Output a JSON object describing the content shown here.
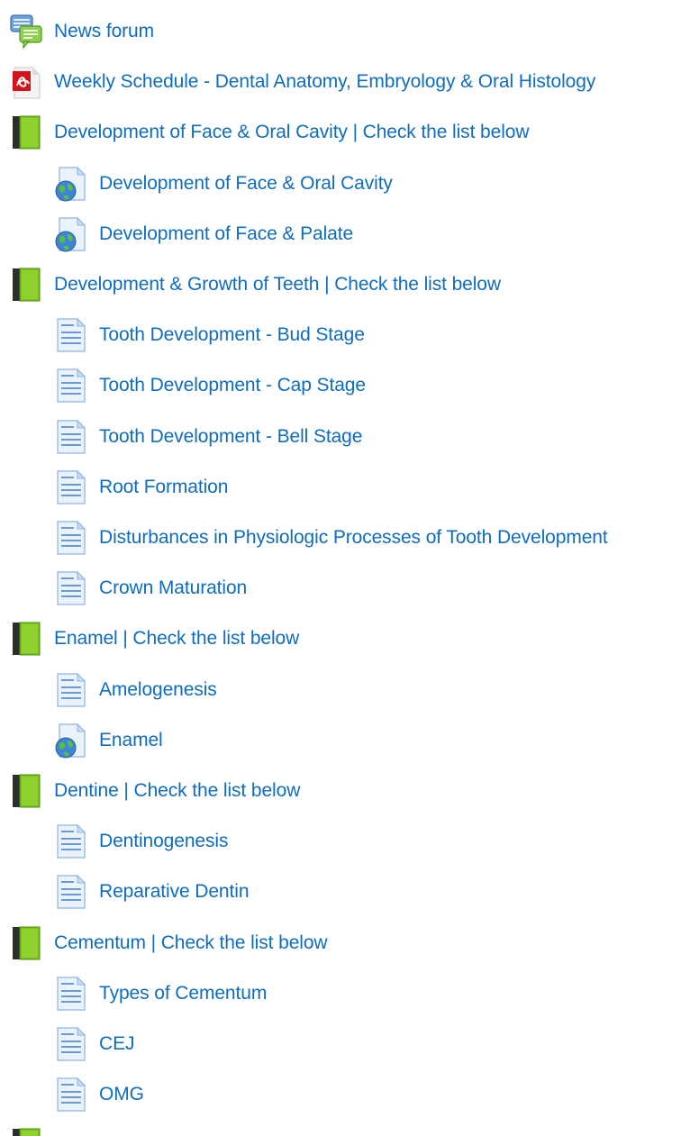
{
  "colors": {
    "link": "#0f6cbf"
  },
  "activities": [
    {
      "label": "News forum",
      "icon": "forum-icon",
      "level": 0
    },
    {
      "label": "Weekly Schedule - Dental Anatomy, Embryology & Oral Histology",
      "icon": "pdf-icon",
      "level": 0
    },
    {
      "label": "Development of Face & Oral Cavity | Check the list below",
      "icon": "book-icon",
      "level": 0
    },
    {
      "label": "Development of Face & Oral Cavity",
      "icon": "url-icon",
      "level": 1
    },
    {
      "label": "Development of Face & Palate",
      "icon": "url-icon",
      "level": 1
    },
    {
      "label": "Development & Growth of Teeth | Check the list below",
      "icon": "book-icon",
      "level": 0
    },
    {
      "label": "Tooth Development - Bud Stage",
      "icon": "page-icon",
      "level": 1
    },
    {
      "label": "Tooth Development - Cap Stage",
      "icon": "page-icon",
      "level": 1
    },
    {
      "label": "Tooth Development - Bell Stage",
      "icon": "page-icon",
      "level": 1
    },
    {
      "label": "Root Formation",
      "icon": "page-icon",
      "level": 1
    },
    {
      "label": "Disturbances in Physiologic Processes of Tooth Development",
      "icon": "page-icon",
      "level": 1
    },
    {
      "label": "Crown Maturation",
      "icon": "page-icon",
      "level": 1
    },
    {
      "label": "Enamel | Check the list below",
      "icon": "book-icon",
      "level": 0
    },
    {
      "label": "Amelogenesis",
      "icon": "page-icon",
      "level": 1
    },
    {
      "label": "Enamel",
      "icon": "url-icon",
      "level": 1
    },
    {
      "label": "Dentine | Check the list below",
      "icon": "book-icon",
      "level": 0
    },
    {
      "label": "Dentinogenesis",
      "icon": "page-icon",
      "level": 1
    },
    {
      "label": "Reparative Dentin",
      "icon": "page-icon",
      "level": 1
    },
    {
      "label": "Cementum | Check the list below",
      "icon": "book-icon",
      "level": 0
    },
    {
      "label": "Types of Cementum",
      "icon": "page-icon",
      "level": 1
    },
    {
      "label": "CEJ",
      "icon": "page-icon",
      "level": 1
    },
    {
      "label": "OMG",
      "icon": "page-icon",
      "level": 1
    },
    {
      "label": "",
      "icon": "book-icon",
      "level": 0
    }
  ]
}
